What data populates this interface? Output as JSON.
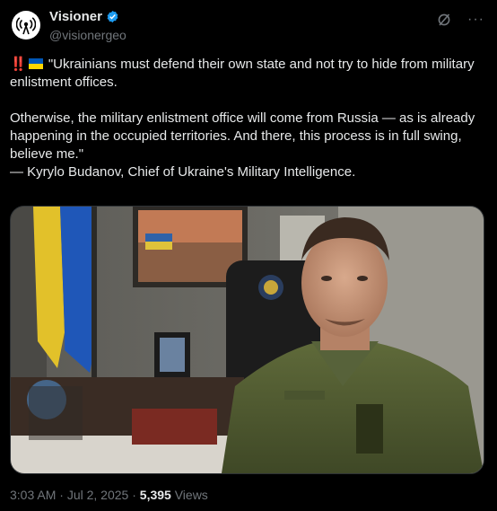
{
  "account": {
    "name": "Visioner",
    "handle": "@visionergeo",
    "avatar_icon": "radio-broadcast-icon",
    "verified_color": "#1d9bf0"
  },
  "toolbar": {
    "grok_icon": "grok-icon",
    "more_label": "···"
  },
  "tweet": {
    "prefix_emoji": "‼️",
    "flag_emoji": "ukraine-flag",
    "line1": "\"Ukrainians must defend their own state and not try to hide from military enlistment offices.",
    "line2": "Otherwise, the military enlistment office will come from Russia — as is already happening in the occupied territories. And there, this process is in full swing, believe me.\"",
    "line3": "— Kyrylo Budanov, Chief of Ukraine's Military Intelligence."
  },
  "meta": {
    "time": "3:03 AM",
    "sep1": " · ",
    "date": "Jul 2, 2025",
    "sep2": " · ",
    "views_count": "5,395",
    "views_label": " Views"
  }
}
